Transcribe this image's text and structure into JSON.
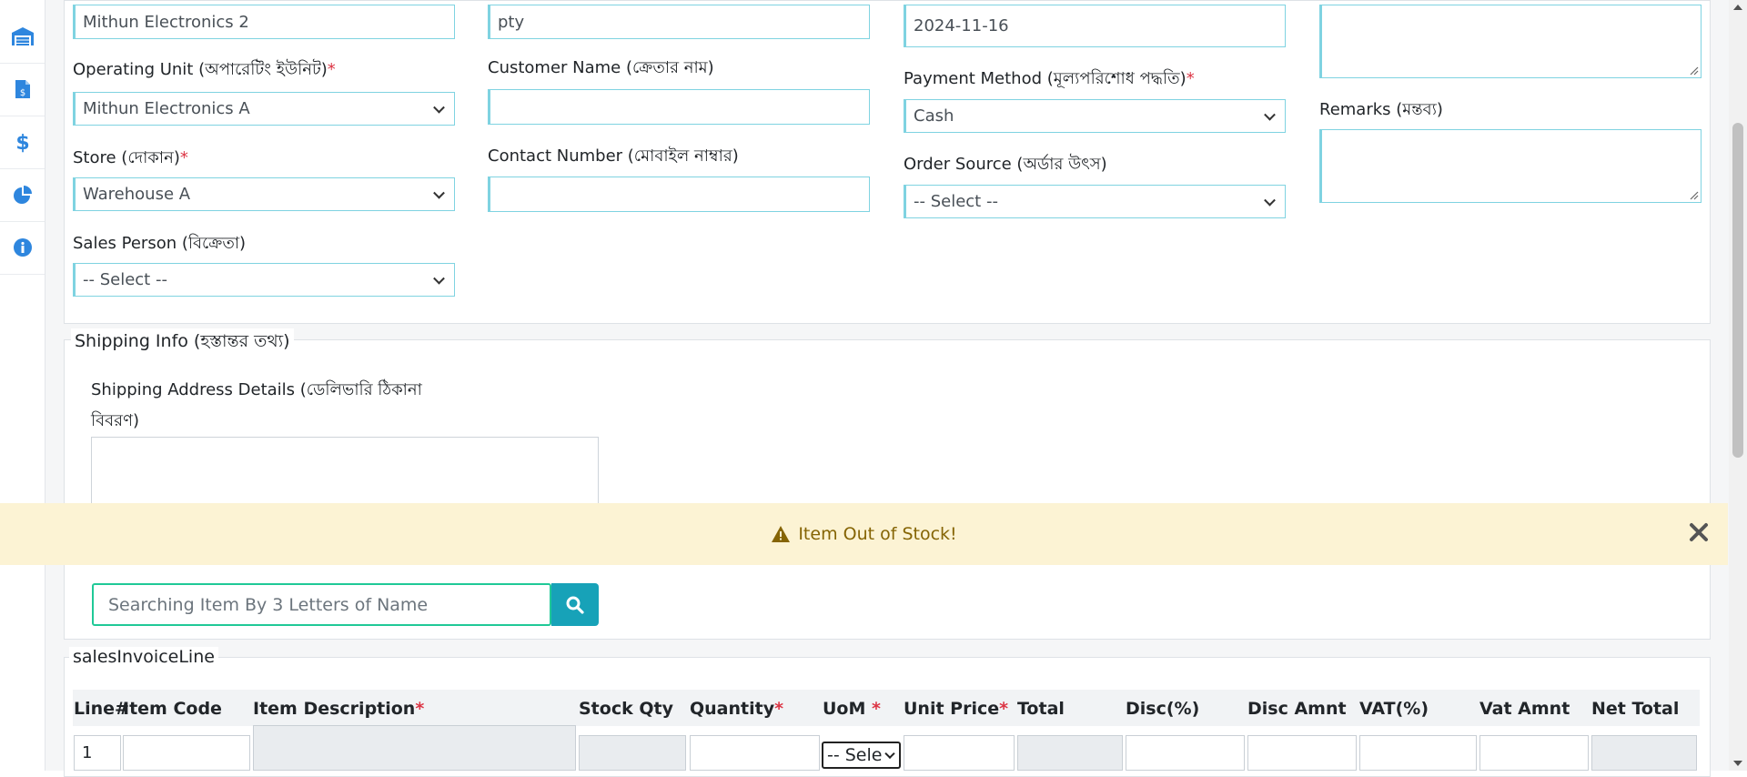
{
  "form": {
    "company_value": "Mithun Electronics 2",
    "customer_type_value": "pty",
    "date_value": "2024-11-16",
    "operating_unit": {
      "label": "Operating Unit (অপারেটিং ইউনিট)",
      "value": "Mithun Electronics A"
    },
    "customer_name": {
      "label": "Customer Name (ক্রেতার নাম)",
      "value": ""
    },
    "payment_method": {
      "label": "Payment Method (মূল্যপরিশোধ পদ্ধতি)",
      "value": "Cash"
    },
    "remarks": {
      "label": "Remarks (মন্তব্য)",
      "value": ""
    },
    "store": {
      "label": "Store (দোকান)",
      "value": "Warehouse A"
    },
    "contact_number": {
      "label": "Contact Number (মোবাইল নাম্বার)",
      "value": ""
    },
    "order_source": {
      "label": "Order Source (অর্ডার উৎস)",
      "value": "-- Select --"
    },
    "sales_person": {
      "label": "Sales Person (বিক্রেতা)",
      "value": "-- Select --"
    },
    "required_mark": "*"
  },
  "shipping": {
    "legend": "Shipping Info (হস্তান্তর তথ্য)",
    "address_label_line1": "Shipping Address Details (ডেলিভারি ঠিকানা",
    "address_label_line2": "বিবরণ)"
  },
  "alert": {
    "message": "Item Out of Stock!"
  },
  "search": {
    "placeholder": "Searching Item By 3 Letters of Name"
  },
  "invoice_lines": {
    "legend": "salesInvoiceLine",
    "headers": [
      "Line#",
      "Item Code",
      "Item Description",
      "Stock Qty",
      "Quantity",
      "UoM",
      "Unit Price",
      "Total",
      "Disc(%)",
      "Disc Amnt",
      "VAT(%)",
      "Vat Amnt",
      "Net Total"
    ],
    "row1": {
      "line_no": "1",
      "uom": "-- Sele"
    }
  },
  "icons": {
    "sidebar": [
      "warehouse-icon",
      "invoice-icon",
      "dollar-icon",
      "pie-chart-icon",
      "info-icon"
    ],
    "accent": "#2e86de",
    "alert_bg": "#fcf3d4",
    "search_button": "#17a2b8"
  }
}
